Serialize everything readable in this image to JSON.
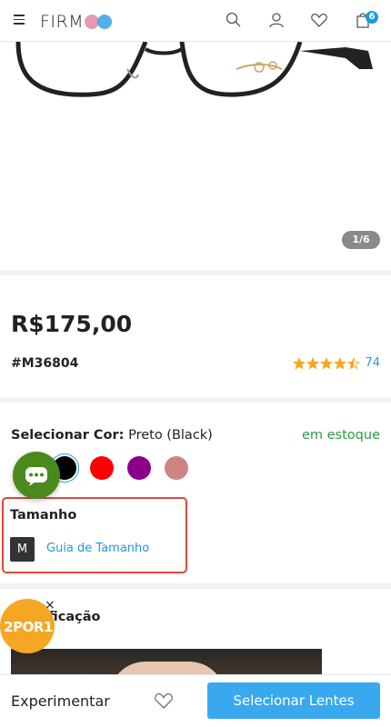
{
  "header": {
    "logo_text": "FIRM",
    "cart_count": "6",
    "icons": [
      "menu-icon",
      "search-icon",
      "user-icon",
      "heart-icon",
      "cart-icon"
    ]
  },
  "gallery": {
    "pager": "1/6"
  },
  "product": {
    "price": "R$175,00",
    "sku": "#M36804",
    "rating_value": 4.5,
    "rating_count": "74"
  },
  "color": {
    "label": "Selecionar Cor:",
    "selected_value": "Preto (Black)",
    "stock": "em estoque",
    "swatches": [
      "#000000",
      "#ff0000",
      "#8b008b",
      "#cd8584"
    ]
  },
  "size": {
    "title": "Tamanho",
    "selected": "M",
    "guide_link": "Guia de Tamanho"
  },
  "spec": {
    "title_visible": "ficação"
  },
  "promo": {
    "text": "2POR1",
    "close": "×"
  },
  "footer": {
    "try_on": "Experimentar",
    "select_lenses": "Selecionar Lentes"
  },
  "colors": {
    "accent": "#1e9ae0",
    "button": "#38a9ef",
    "stock_green": "#2a9d3f",
    "star": "#f5a623",
    "highlight_border": "#e0473a",
    "chat": "#4a8a1c"
  }
}
